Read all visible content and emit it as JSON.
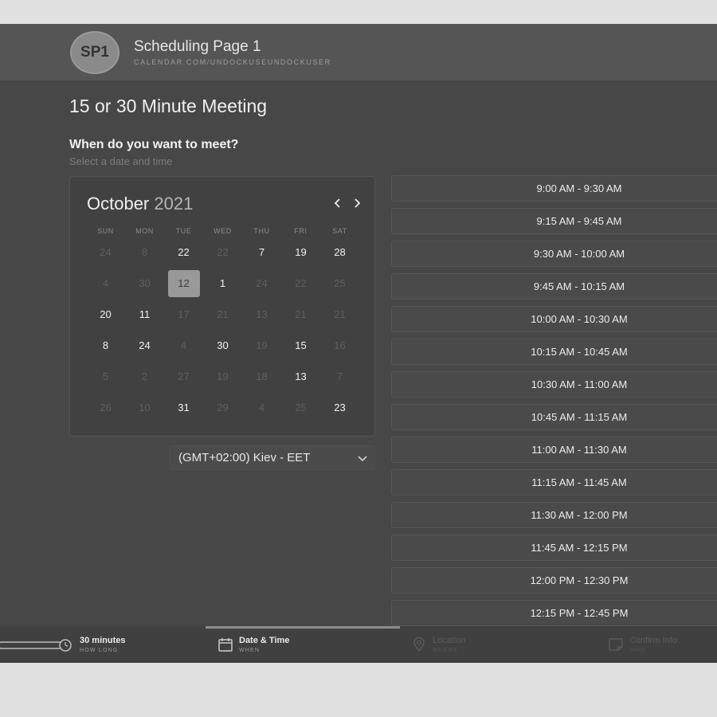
{
  "header": {
    "avatar_initials": "SP1",
    "title": "Scheduling Page 1",
    "url": "CALENDAR.COM/UNDOCKUSEUNDOCKUSER"
  },
  "meeting_title": "15 or 30 Minute Meeting",
  "question": "When do you want to meet?",
  "subtitle": "Select a date and time",
  "calendar": {
    "month": "October",
    "year": "2021",
    "weekdays": [
      "SUN",
      "MON",
      "TUE",
      "WED",
      "THU",
      "FRI",
      "SAT"
    ],
    "selected_day": "12",
    "weeks": [
      [
        [
          "24",
          false
        ],
        [
          "8",
          false
        ],
        [
          "22",
          true
        ],
        [
          "22",
          false
        ],
        [
          "7",
          true
        ],
        [
          "19",
          true
        ],
        [
          "28",
          true
        ]
      ],
      [
        [
          "4",
          false
        ],
        [
          "30",
          false
        ],
        [
          "12",
          true
        ],
        [
          "1",
          true
        ],
        [
          "24",
          false
        ],
        [
          "22",
          false
        ],
        [
          "25",
          false
        ]
      ],
      [
        [
          "20",
          true
        ],
        [
          "11",
          true
        ],
        [
          "17",
          false
        ],
        [
          "21",
          false
        ],
        [
          "13",
          false
        ],
        [
          "21",
          false
        ],
        [
          "21",
          false
        ]
      ],
      [
        [
          "8",
          true
        ],
        [
          "24",
          true
        ],
        [
          "4",
          false
        ],
        [
          "30",
          true
        ],
        [
          "19",
          false
        ],
        [
          "15",
          true
        ],
        [
          "16",
          false
        ]
      ],
      [
        [
          "5",
          false
        ],
        [
          "2",
          false
        ],
        [
          "27",
          false
        ],
        [
          "19",
          false
        ],
        [
          "18",
          false
        ],
        [
          "13",
          true
        ],
        [
          "7",
          false
        ]
      ],
      [
        [
          "26",
          false
        ],
        [
          "10",
          false
        ],
        [
          "31",
          true
        ],
        [
          "29",
          false
        ],
        [
          "4",
          false
        ],
        [
          "25",
          false
        ],
        [
          "23",
          true
        ]
      ]
    ]
  },
  "timezone": "(GMT+02:00) Kiev - EET",
  "time_slots": [
    "9:00 AM - 9:30 AM",
    "9:15 AM - 9:45 AM",
    "9:30 AM - 10:00 AM",
    "9:45 AM - 10:15 AM",
    "10:00 AM - 10:30 AM",
    "10:15 AM - 10:45 AM",
    "10:30 AM - 11:00 AM",
    "10:45 AM - 11:15 AM",
    "11:00 AM - 11:30 AM",
    "11:15 AM - 11:45 AM",
    "11:30 AM - 12:00 PM",
    "11:45 AM - 12:15 PM",
    "12:00 PM - 12:30 PM",
    "12:15 PM - 12:45 PM"
  ],
  "steps": [
    {
      "title": "30 minutes",
      "sub": "HOW LONG",
      "icon": "duration-slider-icon",
      "state": "done"
    },
    {
      "title": "Date & Time",
      "sub": "WHEN",
      "icon": "calendar-icon",
      "state": "active"
    },
    {
      "title": "Location",
      "sub": "WHERE",
      "icon": "location-pin-icon",
      "state": "disabled"
    },
    {
      "title": "Confirm Info",
      "sub": "WHO",
      "icon": "note-icon",
      "state": "disabled"
    }
  ],
  "colors": {
    "background": "#474747",
    "header": "#555555",
    "selected_day": "#999999"
  }
}
